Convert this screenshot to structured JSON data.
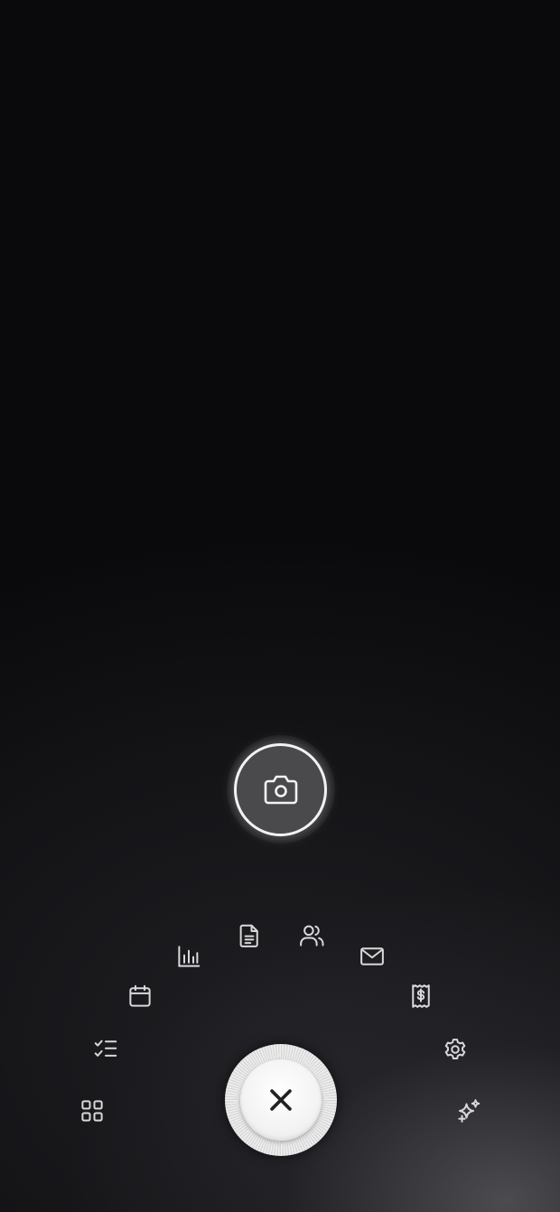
{
  "screen": {
    "background": "#0a0a0c",
    "accent": "#f2f2f2"
  },
  "camera_button": {
    "icon": "camera-icon"
  },
  "close_button": {
    "icon": "close-icon"
  },
  "radial_menu": {
    "items": [
      {
        "icon": "grid-icon"
      },
      {
        "icon": "checklist-icon"
      },
      {
        "icon": "calendar-icon"
      },
      {
        "icon": "bar-chart-icon"
      },
      {
        "icon": "document-icon"
      },
      {
        "icon": "users-icon"
      },
      {
        "icon": "mail-icon"
      },
      {
        "icon": "receipt-icon"
      },
      {
        "icon": "settings-icon"
      },
      {
        "icon": "sparkles-icon"
      }
    ]
  }
}
